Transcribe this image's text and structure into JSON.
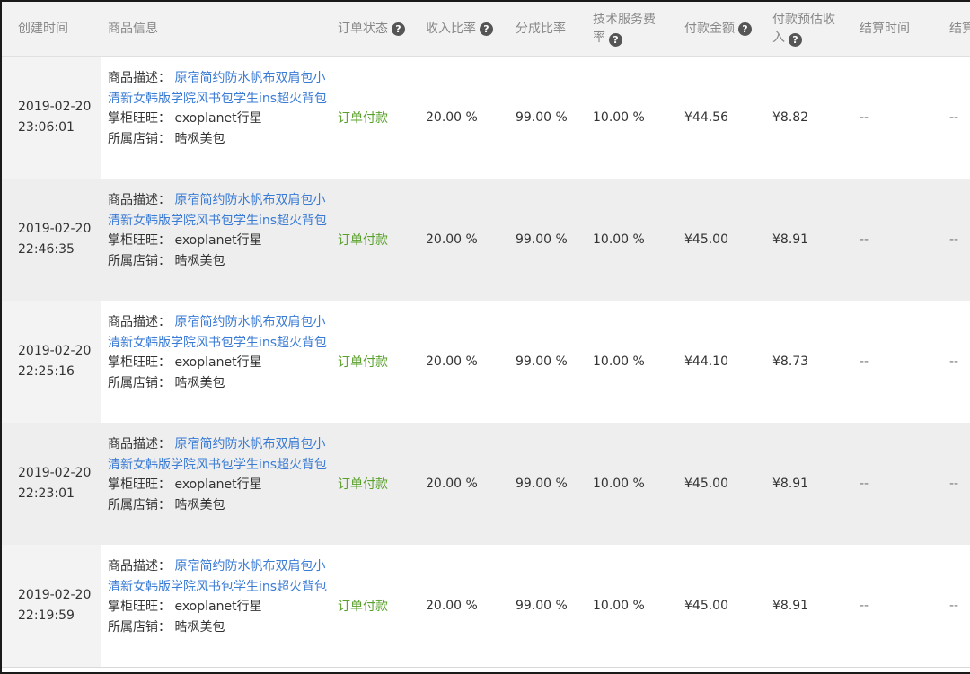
{
  "columns": {
    "created": "创建时间",
    "goods": "商品信息",
    "status": "订单状态",
    "income_rate": "收入比率",
    "share_rate": "分成比率",
    "service_rate": "技术服务费率",
    "pay_amount": "付款金额",
    "est_income": "付款预估收入",
    "settle_time": "结算时间",
    "settle_more": "结算"
  },
  "labels": {
    "desc": "商品描述：",
    "seller": "掌柜旺旺：",
    "shop": "所属店铺："
  },
  "icons": {
    "help": "question-circle-icon",
    "help_glyph": "?"
  },
  "colors": {
    "link": "#3a7bd5",
    "status": "#5aa02c",
    "header_bg": "#f2f2f2"
  },
  "orders": [
    {
      "date": "2019-02-20",
      "time": "23:06:01",
      "title": "原宿简约防水帆布双肩包小清新女韩版学院风书包学生ins超火背包",
      "seller": "exoplanet行星",
      "shop": "晧枫美包",
      "status": "订单付款",
      "income_rate": "20.00 %",
      "share_rate": "99.00 %",
      "service_rate": "10.00 %",
      "pay_amount": "¥44.56",
      "est_income": "¥8.82",
      "settle_time": "--",
      "settle_more": "--"
    },
    {
      "date": "2019-02-20",
      "time": "22:46:35",
      "title": "原宿简约防水帆布双肩包小清新女韩版学院风书包学生ins超火背包",
      "seller": "exoplanet行星",
      "shop": "晧枫美包",
      "status": "订单付款",
      "income_rate": "20.00 %",
      "share_rate": "99.00 %",
      "service_rate": "10.00 %",
      "pay_amount": "¥45.00",
      "est_income": "¥8.91",
      "settle_time": "--",
      "settle_more": "--"
    },
    {
      "date": "2019-02-20",
      "time": "22:25:16",
      "title": "原宿简约防水帆布双肩包小清新女韩版学院风书包学生ins超火背包",
      "seller": "exoplanet行星",
      "shop": "晧枫美包",
      "status": "订单付款",
      "income_rate": "20.00 %",
      "share_rate": "99.00 %",
      "service_rate": "10.00 %",
      "pay_amount": "¥44.10",
      "est_income": "¥8.73",
      "settle_time": "--",
      "settle_more": "--"
    },
    {
      "date": "2019-02-20",
      "time": "22:23:01",
      "title": "原宿简约防水帆布双肩包小清新女韩版学院风书包学生ins超火背包",
      "seller": "exoplanet行星",
      "shop": "晧枫美包",
      "status": "订单付款",
      "income_rate": "20.00 %",
      "share_rate": "99.00 %",
      "service_rate": "10.00 %",
      "pay_amount": "¥45.00",
      "est_income": "¥8.91",
      "settle_time": "--",
      "settle_more": "--"
    },
    {
      "date": "2019-02-20",
      "time": "22:19:59",
      "title": "原宿简约防水帆布双肩包小清新女韩版学院风书包学生ins超火背包",
      "seller": "exoplanet行星",
      "shop": "晧枫美包",
      "status": "订单付款",
      "income_rate": "20.00 %",
      "share_rate": "99.00 %",
      "service_rate": "10.00 %",
      "pay_amount": "¥45.00",
      "est_income": "¥8.91",
      "settle_time": "--",
      "settle_more": "--"
    }
  ]
}
